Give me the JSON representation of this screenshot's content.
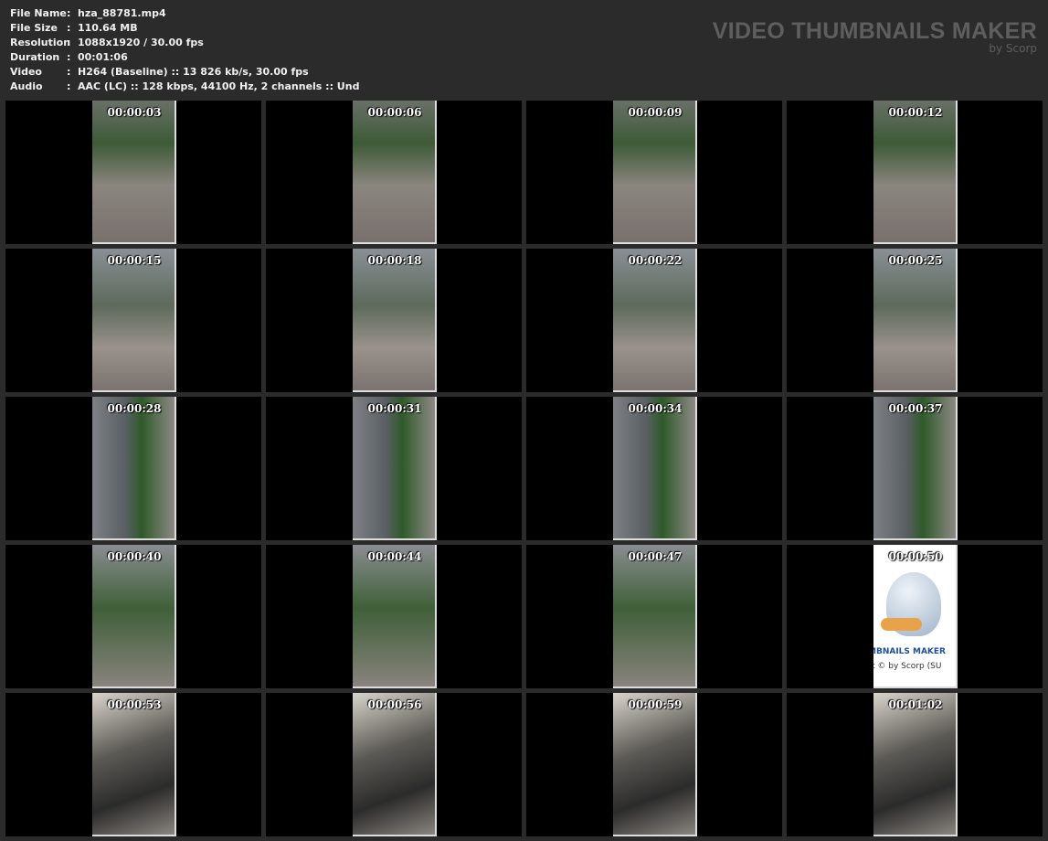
{
  "info": [
    {
      "label": "File Name",
      "value": "hza_88781.mp4"
    },
    {
      "label": "File Size",
      "value": "110.64 MB"
    },
    {
      "label": "Resolution",
      "value": "1088x1920 / 30.00 fps"
    },
    {
      "label": "Duration",
      "value": "00:01:06"
    },
    {
      "label": "Video",
      "value": "H264 (Baseline) :: 13 826 kb/s, 30.00 fps"
    },
    {
      "label": "Audio",
      "value": "AAC (LC) :: 128 kbps, 44100 Hz, 2 channels :: Und"
    }
  ],
  "separator": ":",
  "brand": {
    "title": "VIDEO THUMBNAILS MAKER",
    "subtitle": "by Scorp"
  },
  "logo_frame": {
    "line1": "MBNAILS MAKER",
    "line2": "t © by Scorp (SU"
  },
  "frames": [
    "00:00:03",
    "00:00:06",
    "00:00:09",
    "00:00:12",
    "00:00:15",
    "00:00:18",
    "00:00:22",
    "00:00:25",
    "00:00:28",
    "00:00:31",
    "00:00:34",
    "00:00:37",
    "00:00:40",
    "00:00:44",
    "00:00:47",
    "00:00:50",
    "00:00:53",
    "00:00:56",
    "00:00:59",
    "00:01:02"
  ]
}
